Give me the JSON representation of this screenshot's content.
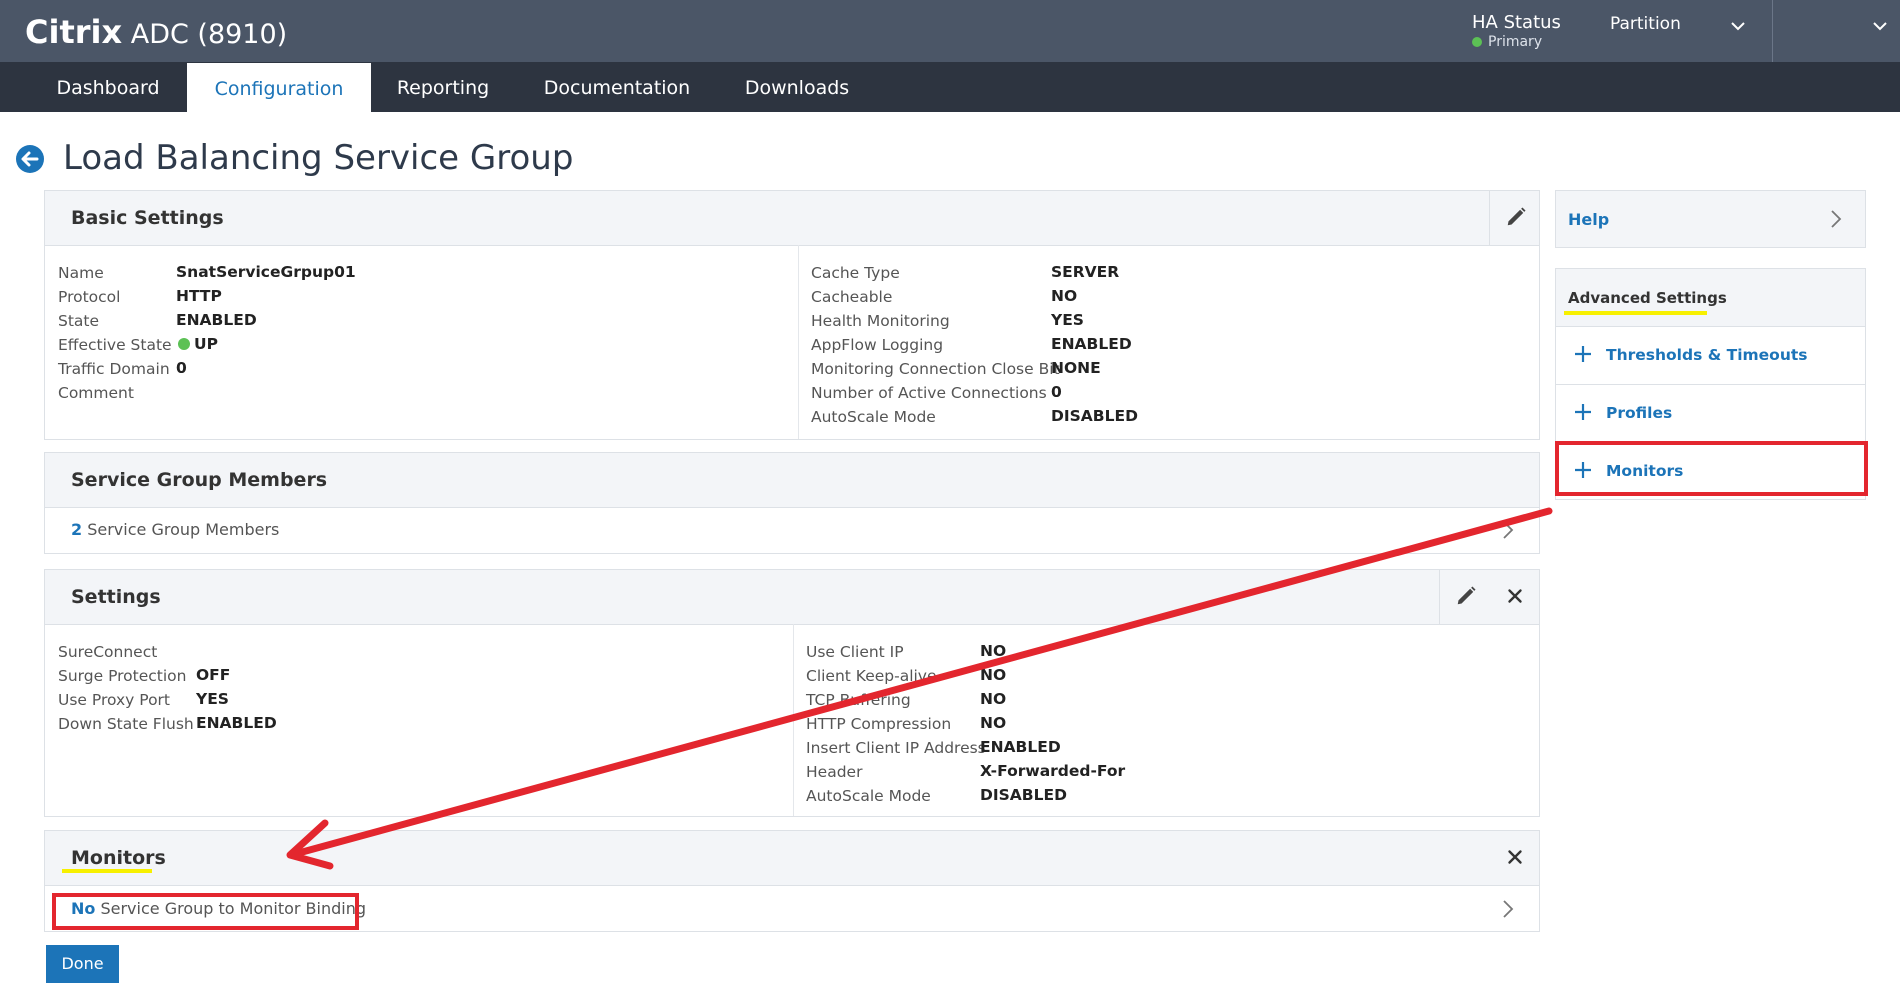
{
  "header": {
    "brand_bold": "Citrix",
    "brand_rest": " ADC (8910)",
    "ha_status_label": "HA Status",
    "ha_status_value": "Primary",
    "partition_label": "Partition"
  },
  "nav": {
    "tabs": [
      {
        "label": "Dashboard"
      },
      {
        "label": "Configuration"
      },
      {
        "label": "Reporting"
      },
      {
        "label": "Documentation"
      },
      {
        "label": "Downloads"
      }
    ],
    "active": "Configuration"
  },
  "page": {
    "title": "Load Balancing Service Group"
  },
  "basic_settings": {
    "title": "Basic Settings",
    "left": [
      {
        "key": "Name",
        "value": "SnatServiceGrpup01"
      },
      {
        "key": "Protocol",
        "value": "HTTP"
      },
      {
        "key": "State",
        "value": "ENABLED"
      },
      {
        "key": "Effective State",
        "value": "UP"
      },
      {
        "key": "Traffic Domain",
        "value": "0"
      },
      {
        "key": "Comment",
        "value": ""
      }
    ],
    "right": [
      {
        "key": "Cache Type",
        "value": "SERVER"
      },
      {
        "key": "Cacheable",
        "value": "NO"
      },
      {
        "key": "Health Monitoring",
        "value": "YES"
      },
      {
        "key": "AppFlow Logging",
        "value": "ENABLED"
      },
      {
        "key": "Monitoring Connection Close Bit",
        "value": "NONE"
      },
      {
        "key": "Number of Active Connections",
        "value": "0"
      },
      {
        "key": "AutoScale Mode",
        "value": "DISABLED"
      }
    ]
  },
  "members": {
    "title": "Service Group Members",
    "count": "2",
    "text": " Service Group Members"
  },
  "settings": {
    "title": "Settings",
    "left": [
      {
        "key": "SureConnect",
        "value": ""
      },
      {
        "key": "Surge Protection",
        "value": "OFF"
      },
      {
        "key": "Use Proxy Port",
        "value": "YES"
      },
      {
        "key": "Down State Flush",
        "value": "ENABLED"
      }
    ],
    "right": [
      {
        "key": "Use Client IP",
        "value": "NO"
      },
      {
        "key": "Client Keep-alive",
        "value": "NO"
      },
      {
        "key": "TCP Buffering",
        "value": "NO"
      },
      {
        "key": "HTTP Compression",
        "value": "NO"
      },
      {
        "key": "Insert Client IP Address",
        "value": "ENABLED"
      },
      {
        "key": "Header",
        "value": "X-Forwarded-For"
      },
      {
        "key": "AutoScale Mode",
        "value": "DISABLED"
      }
    ]
  },
  "monitors": {
    "title": "Monitors",
    "no_label": "No",
    "text": " Service Group to Monitor Binding"
  },
  "sidebar": {
    "help_label": "Help",
    "advanced_label": "Advanced Settings",
    "items": [
      {
        "label": "Thresholds & Timeouts"
      },
      {
        "label": "Profiles"
      },
      {
        "label": "Monitors"
      }
    ]
  },
  "actions": {
    "done_label": "Done"
  },
  "colors": {
    "header_bg": "#4b5667",
    "nav_bg": "#2d3440",
    "accent": "#1c74b8",
    "status_up": "#5cc155",
    "annotation_red": "#e3262e",
    "annotation_yellow": "#f7f000"
  }
}
